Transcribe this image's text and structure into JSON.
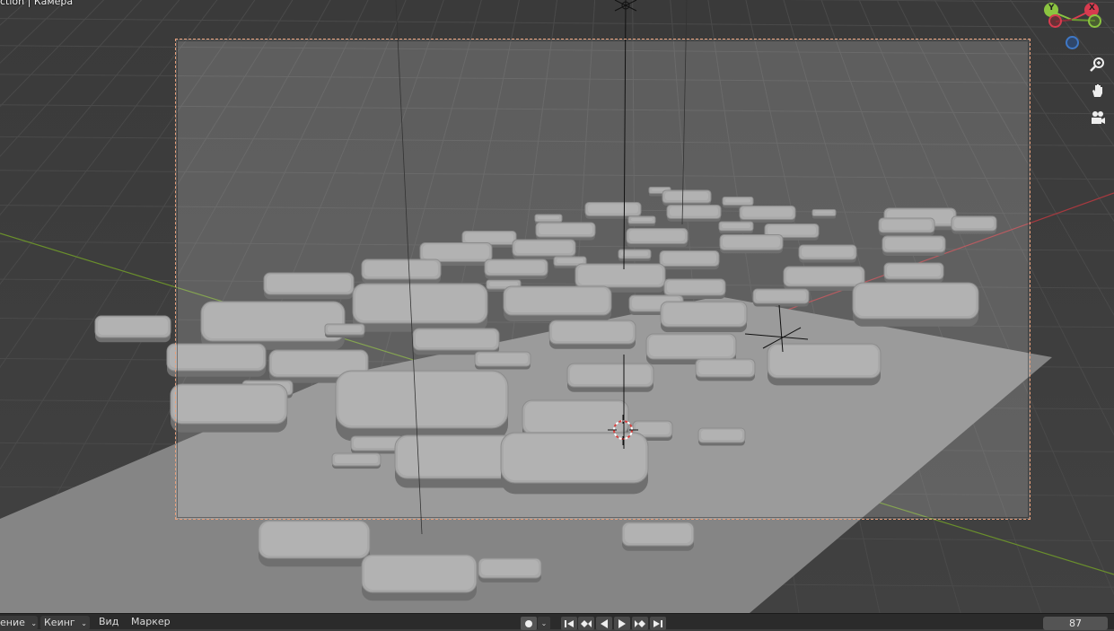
{
  "viewport": {
    "title": "ction | Камера",
    "side_tools": [
      {
        "name": "zoom-icon"
      },
      {
        "name": "hand-pan-icon"
      },
      {
        "name": "camera-view-icon"
      }
    ],
    "gizmo": {
      "y_label": "Y",
      "x_label": "X",
      "colors": {
        "x": "#d93b4f",
        "y": "#8bc440",
        "z": "#3f78c6"
      }
    }
  },
  "timeline": {
    "playback_dropdown": "ение",
    "keying_dropdown": "Кеинг",
    "menu_view": "Вид",
    "menu_marker": "Маркер",
    "current_frame": "87",
    "controls": [
      "record-icon",
      "jump-start-icon",
      "prev-keyframe-icon",
      "play-reverse-icon",
      "play-icon",
      "next-keyframe-icon",
      "jump-end-icon"
    ]
  },
  "colors": {
    "background": "#3d3d3d",
    "camera_frame": "#e8a07c",
    "x_axis": "#a8393f",
    "y_axis": "#6a8f2c"
  }
}
